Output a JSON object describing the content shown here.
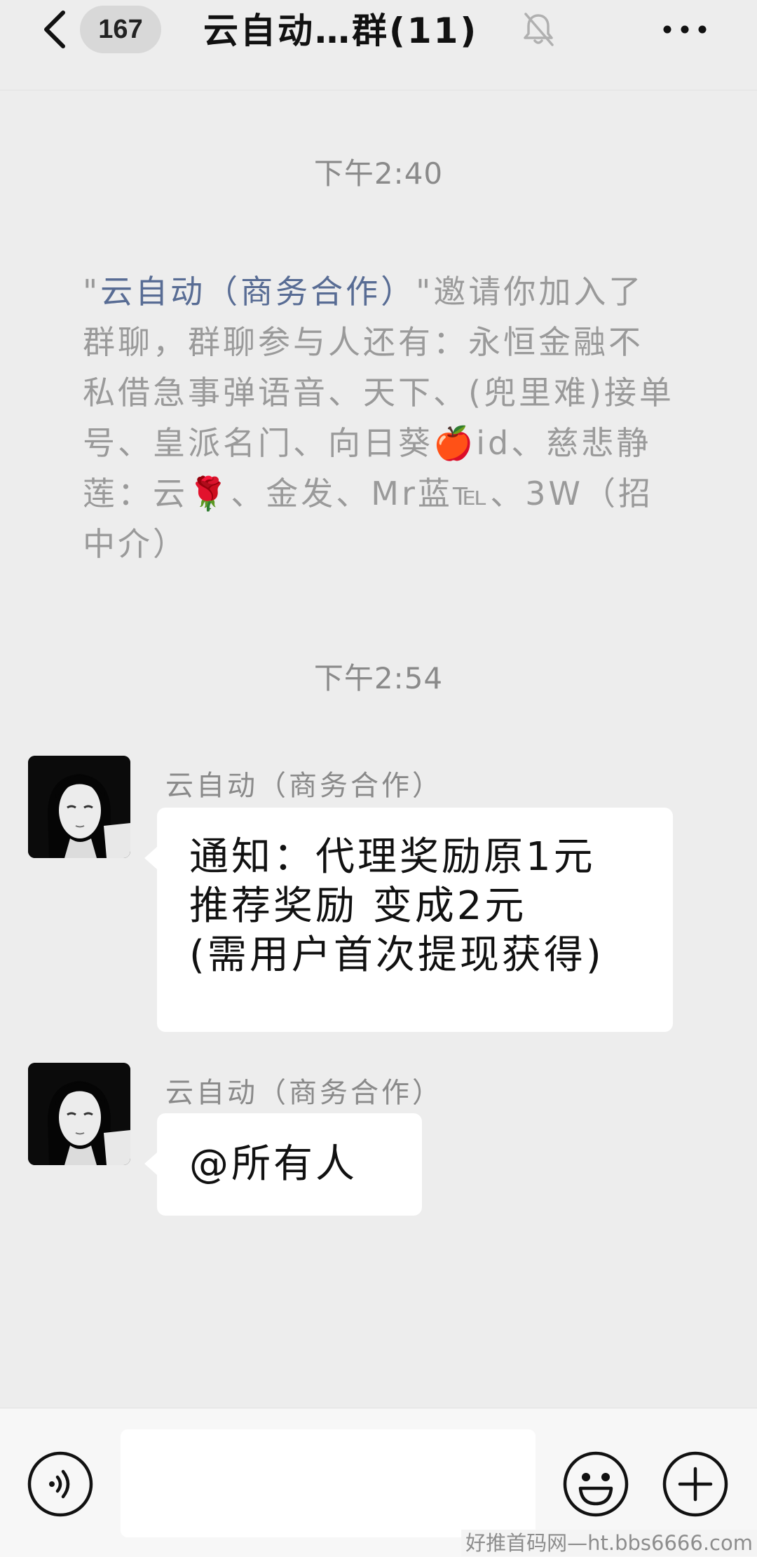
{
  "header": {
    "unread_count": "167",
    "title": "云自动…群(11)"
  },
  "icons": {
    "back": "chevron-left-icon",
    "mute": "bell-off-icon",
    "more": "more-dots-icon",
    "voice": "voice-icon",
    "emoji": "emoji-icon",
    "plus": "plus-icon"
  },
  "timeline": {
    "time_1": "下午2:40",
    "system_message": {
      "quote_open": "\"",
      "inviter": "云自动（商务合作）",
      "text": "\"邀请你加入了群聊，群聊参与人还有：永恒金融不私借急事弹语音、天下、(兜里难)接单号、皇派名门、向日葵🍎id、慈悲静莲：云🌹、金发、Mr蓝℡、3W（招中介）"
    },
    "time_2": "下午2:54"
  },
  "messages": [
    {
      "sender": "云自动（商务合作）",
      "lines": [
        "通知：代理奖励原1元",
        "推荐奖励 变成2元",
        "(需用户首次提现获得)"
      ]
    },
    {
      "sender": "云自动（商务合作）",
      "lines": [
        "@所有人"
      ]
    }
  ],
  "input": {
    "value": "",
    "placeholder": ""
  },
  "watermark": "好推首码网—ht.bbs6666.com",
  "colors": {
    "background": "#ededed",
    "bubble": "#ffffff",
    "link_name": "#586c94",
    "muted_text": "#8a8a8a"
  }
}
